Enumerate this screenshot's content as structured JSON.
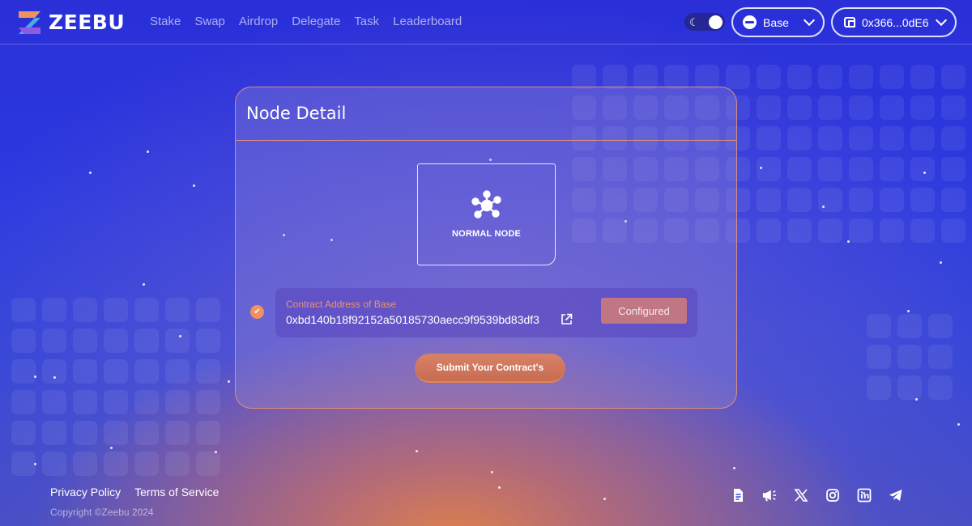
{
  "brand": {
    "name": "ZEEBU"
  },
  "nav": {
    "items": [
      {
        "label": "Stake"
      },
      {
        "label": "Swap"
      },
      {
        "label": "Airdrop"
      },
      {
        "label": "Delegate"
      },
      {
        "label": "Task"
      },
      {
        "label": "Leaderboard"
      }
    ]
  },
  "header": {
    "network_label": "Base",
    "wallet_label": "0x366...0dE6",
    "theme": "dark-toggle"
  },
  "card": {
    "title": "Node Detail",
    "node_type": "NORMAL NODE",
    "contract_label": "Contract Address of Base",
    "contract_address": "0xbd140b18f92152a50185730aecc9f9539bd83df3",
    "status_button": "Configured",
    "submit_button": "Submit Your Contract's"
  },
  "footer": {
    "privacy": "Privacy Policy",
    "terms": "Terms of Service",
    "copyright": "Copyright ©Zeebu 2024",
    "social_icons": [
      "document-icon",
      "megaphone-icon",
      "x-icon",
      "instagram-icon",
      "linkedin-icon",
      "telegram-icon"
    ]
  },
  "colors": {
    "accent": "#f0915e",
    "background_blue": "#2c3be0",
    "card_border": "#f09670"
  }
}
